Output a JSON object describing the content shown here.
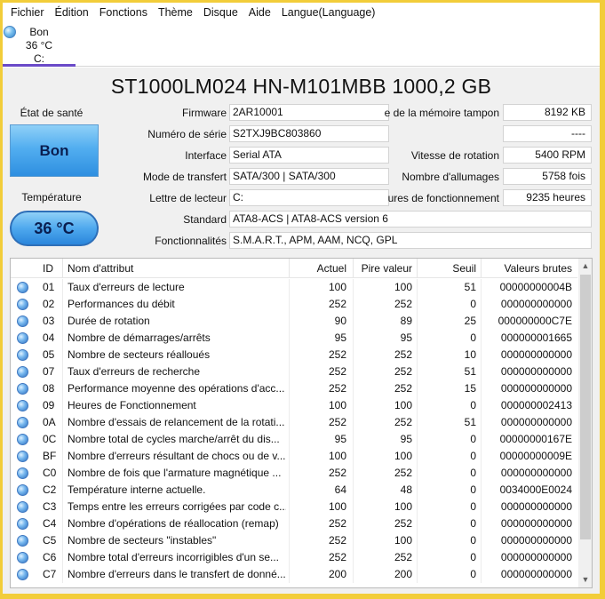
{
  "menu": [
    "Fichier",
    "Édition",
    "Fonctions",
    "Thème",
    "Disque",
    "Aide",
    "Langue(Language)"
  ],
  "disk_tab": {
    "status": "Bon",
    "temp": "36 °C",
    "letter": "C:"
  },
  "model": "ST1000LM024 HN-M101MBB 1000,2 GB",
  "health": {
    "label": "État de santé",
    "value": "Bon"
  },
  "temperature": {
    "label": "Température",
    "value": "36 °C"
  },
  "left_fields": {
    "firmware": {
      "label": "Firmware",
      "value": "2AR10001"
    },
    "serial": {
      "label": "Numéro de série",
      "value": "S2TXJ9BC803860"
    },
    "interface": {
      "label": "Interface",
      "value": "Serial ATA"
    },
    "transfer": {
      "label": "Mode de transfert",
      "value": "SATA/300 | SATA/300"
    },
    "drive_letter": {
      "label": "Lettre de lecteur",
      "value": "C:"
    }
  },
  "right_fields": {
    "buffer": {
      "label": "e de la mémoire tampon",
      "value": "8192 KB"
    },
    "blank": {
      "label": "",
      "value": "----"
    },
    "rotation": {
      "label": "Vitesse de rotation",
      "value": "5400 RPM"
    },
    "power_on_count": {
      "label": "Nombre d'allumages",
      "value": "5758 fois"
    },
    "power_on_hours": {
      "label": "ures de fonctionnement",
      "value": "9235 heures"
    }
  },
  "wide_fields": {
    "standard": {
      "label": "Standard",
      "value": "ATA8-ACS | ATA8-ACS version 6"
    },
    "features": {
      "label": "Fonctionnalités",
      "value": "S.M.A.R.T., APM, AAM, NCQ, GPL"
    }
  },
  "table": {
    "headers": [
      "ID",
      "Nom d'attribut",
      "Actuel",
      "Pire valeur",
      "Seuil",
      "Valeurs brutes"
    ],
    "rows": [
      [
        "01",
        "Taux d'erreurs de lecture",
        "100",
        "100",
        "51",
        "00000000004B"
      ],
      [
        "02",
        "Performances du débit",
        "252",
        "252",
        "0",
        "000000000000"
      ],
      [
        "03",
        "Durée de rotation",
        "90",
        "89",
        "25",
        "000000000C7E"
      ],
      [
        "04",
        "Nombre de démarrages/arrêts",
        "95",
        "95",
        "0",
        "000000001665"
      ],
      [
        "05",
        "Nombre de secteurs réalloués",
        "252",
        "252",
        "10",
        "000000000000"
      ],
      [
        "07",
        "Taux d'erreurs de recherche",
        "252",
        "252",
        "51",
        "000000000000"
      ],
      [
        "08",
        "Performance moyenne des opérations d'acc...",
        "252",
        "252",
        "15",
        "000000000000"
      ],
      [
        "09",
        "Heures de Fonctionnement",
        "100",
        "100",
        "0",
        "000000002413"
      ],
      [
        "0A",
        "Nombre d'essais de relancement de la rotati...",
        "252",
        "252",
        "51",
        "000000000000"
      ],
      [
        "0C",
        "Nombre total de cycles marche/arrêt du dis...",
        "95",
        "95",
        "0",
        "00000000167E"
      ],
      [
        "BF",
        "Nombre d'erreurs résultant de chocs ou de v...",
        "100",
        "100",
        "0",
        "00000000009E"
      ],
      [
        "C0",
        "Nombre de fois que l'armature magnétique ...",
        "252",
        "252",
        "0",
        "000000000000"
      ],
      [
        "C2",
        "Température interne actuelle.",
        "64",
        "48",
        "0",
        "0034000E0024"
      ],
      [
        "C3",
        "Temps entre les erreurs corrigées par code c...",
        "100",
        "100",
        "0",
        "000000000000"
      ],
      [
        "C4",
        "Nombre d'opérations de réallocation (remap)",
        "252",
        "252",
        "0",
        "000000000000"
      ],
      [
        "C5",
        "Nombre de secteurs \"instables\"",
        "252",
        "100",
        "0",
        "000000000000"
      ],
      [
        "C6",
        "Nombre total d'erreurs incorrigibles d'un se...",
        "252",
        "252",
        "0",
        "000000000000"
      ],
      [
        "C7",
        "Nombre d'erreurs dans le transfert de donné...",
        "200",
        "200",
        "0",
        "000000000000"
      ]
    ]
  },
  "colors": {
    "accent": "#6a4ac8",
    "good_blue": "#4ea8ee",
    "frame": "#f2cd3a"
  }
}
